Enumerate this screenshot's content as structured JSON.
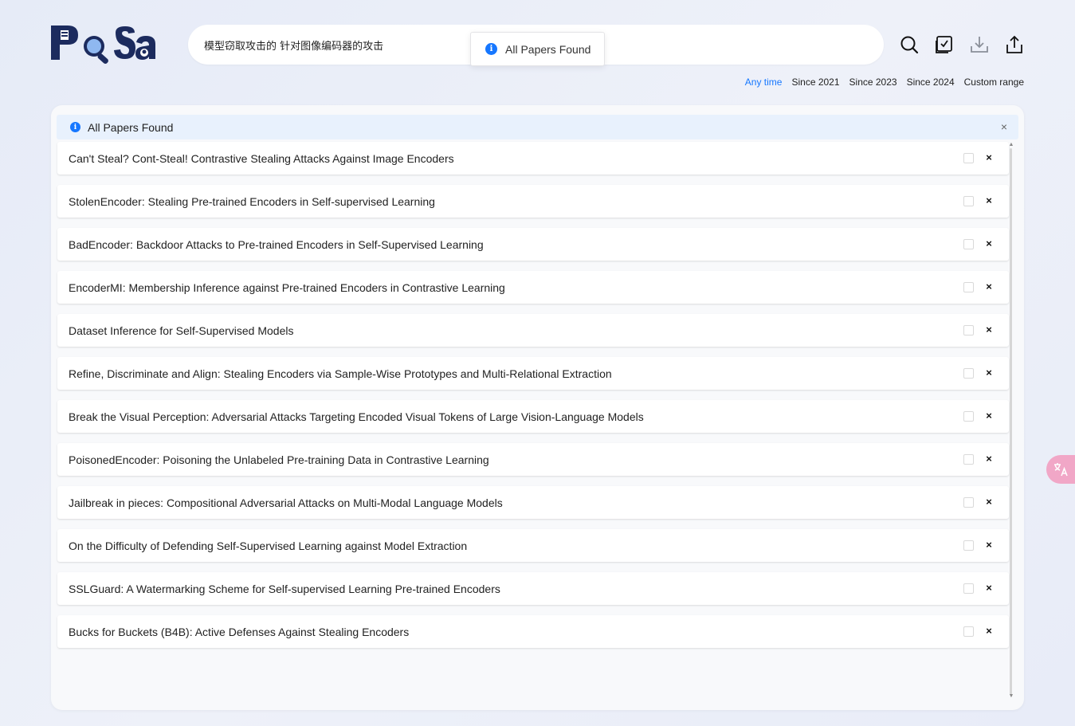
{
  "logo": {
    "text": "PaSa"
  },
  "search": {
    "value": "模型窃取攻击的 针对图像编码器的攻击"
  },
  "toast": {
    "text": "All Papers Found"
  },
  "toolbar": {
    "icons": [
      "search-icon",
      "select-all-icon",
      "download-icon",
      "share-icon"
    ]
  },
  "filters": [
    {
      "label": "Any time",
      "active": true
    },
    {
      "label": "Since 2021",
      "active": false
    },
    {
      "label": "Since 2023",
      "active": false
    },
    {
      "label": "Since 2024",
      "active": false
    },
    {
      "label": "Custom range",
      "active": false
    }
  ],
  "alert": {
    "text": "All Papers Found",
    "close": "×"
  },
  "papers": [
    "Can't Steal? Cont-Steal! Contrastive Stealing Attacks Against Image Encoders",
    "StolenEncoder: Stealing Pre-trained Encoders in Self-supervised Learning",
    "BadEncoder: Backdoor Attacks to Pre-trained Encoders in Self-Supervised Learning",
    "EncoderMI: Membership Inference against Pre-trained Encoders in Contrastive Learning",
    "Dataset Inference for Self-Supervised Models",
    "Refine, Discriminate and Align: Stealing Encoders via Sample-Wise Prototypes and Multi-Relational Extraction",
    "Break the Visual Perception: Adversarial Attacks Targeting Encoded Visual Tokens of Large Vision-Language Models",
    "PoisonedEncoder: Poisoning the Unlabeled Pre-training Data in Contrastive Learning",
    "Jailbreak in pieces: Compositional Adversarial Attacks on Multi-Modal Language Models",
    "On the Difficulty of Defending Self-Supervised Learning against Model Extraction",
    "SSLGuard: A Watermarking Scheme for Self-supervised Learning Pre-trained Encoders",
    "Bucks for Buckets (B4B): Active Defenses Against Stealing Encoders"
  ],
  "row_remove": "×",
  "colors": {
    "accent": "#1677ff",
    "logo_navy": "#1c2b5e",
    "translate_bg": "#f1a7c7"
  }
}
